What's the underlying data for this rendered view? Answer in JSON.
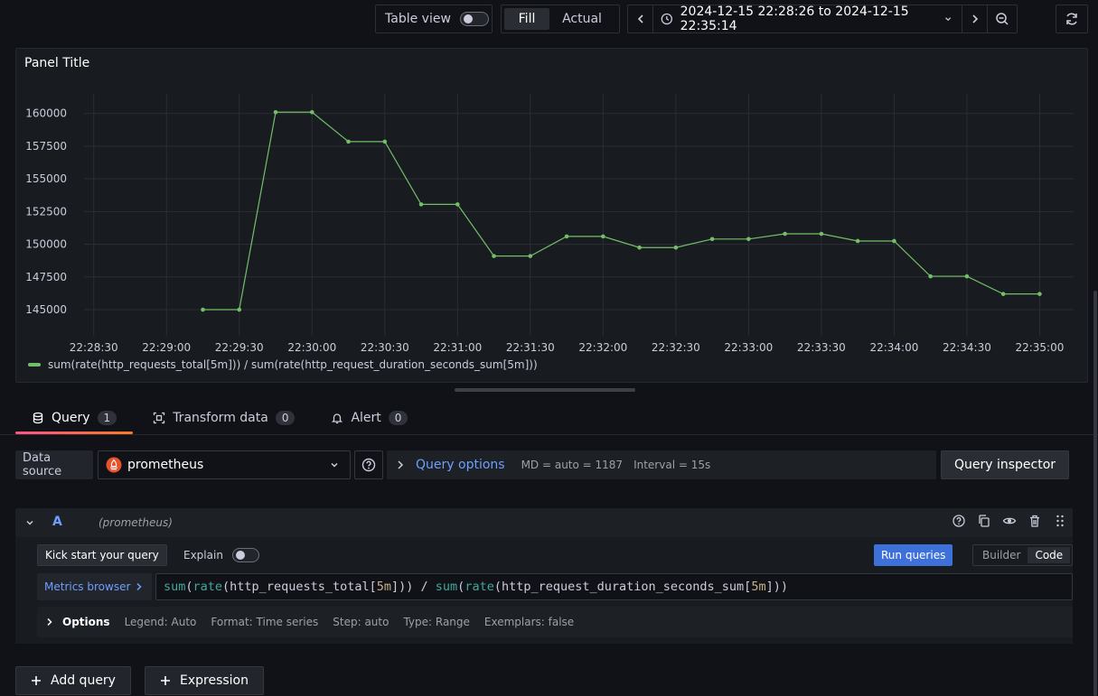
{
  "toolbar": {
    "table_view_label": "Table view",
    "table_view_on": false,
    "fill_label": "Fill",
    "actual_label": "Actual",
    "time_range": "2024-12-15 22:28:26 to 2024-12-15 22:35:14"
  },
  "panel": {
    "title": "Panel Title",
    "legend_label": "sum(rate(http_requests_total[5m])) / sum(rate(http_request_duration_seconds_sum[5m]))"
  },
  "chart_data": {
    "type": "line",
    "title": "Panel Title",
    "xlabel": "",
    "ylabel": "",
    "x_ticks": [
      "22:28:30",
      "22:29:00",
      "22:29:30",
      "22:30:00",
      "22:30:30",
      "22:31:00",
      "22:31:30",
      "22:32:00",
      "22:32:30",
      "22:33:00",
      "22:33:30",
      "22:34:00",
      "22:34:30",
      "22:35:00"
    ],
    "y_ticks": [
      145000,
      147500,
      150000,
      152500,
      155000,
      157500,
      160000
    ],
    "ylim": [
      143000,
      161500
    ],
    "grid": true,
    "legend_position": "bottom-left",
    "series": [
      {
        "name": "sum(rate(http_requests_total[5m])) / sum(rate(http_request_duration_seconds_sum[5m]))",
        "color": "#73bf69",
        "x": [
          "22:29:15",
          "22:29:30",
          "22:29:45",
          "22:30:00",
          "22:30:15",
          "22:30:30",
          "22:30:45",
          "22:31:00",
          "22:31:15",
          "22:31:30",
          "22:31:45",
          "22:32:00",
          "22:32:15",
          "22:32:30",
          "22:32:45",
          "22:33:00",
          "22:33:15",
          "22:33:30",
          "22:33:45",
          "22:34:00",
          "22:34:15",
          "22:34:30",
          "22:34:45",
          "22:35:00"
        ],
        "y": [
          145000,
          145000,
          160100,
          160100,
          157850,
          157850,
          153050,
          153050,
          149100,
          149100,
          150600,
          150600,
          149750,
          149750,
          150400,
          150400,
          150800,
          150800,
          150250,
          150250,
          147550,
          147550,
          146200,
          146200
        ]
      }
    ]
  },
  "tabs": [
    {
      "label": "Query",
      "count": "1"
    },
    {
      "label": "Transform data",
      "count": "0"
    },
    {
      "label": "Alert",
      "count": "0"
    }
  ],
  "datasource": {
    "label": "Data source",
    "selected": "prometheus",
    "query_options_label": "Query options",
    "md": "MD = auto = 1187",
    "interval": "Interval = 15s",
    "inspector_label": "Query inspector"
  },
  "query": {
    "ref": "A",
    "ds_name": "(prometheus)",
    "kick_start_label": "Kick start your query",
    "explain_label": "Explain",
    "run_label": "Run queries",
    "builder_label": "Builder",
    "code_label": "Code",
    "metrics_browser_label": "Metrics browser",
    "expr": "sum(rate(http_requests_total[5m])) / sum(rate(http_request_duration_seconds_sum[5m]))",
    "options_title": "Options",
    "options": [
      "Legend: Auto",
      "Format: Time series",
      "Step: auto",
      "Type: Range",
      "Exemplars: false"
    ]
  },
  "bottom": {
    "add_query_label": "Add query",
    "expression_label": "Expression"
  }
}
